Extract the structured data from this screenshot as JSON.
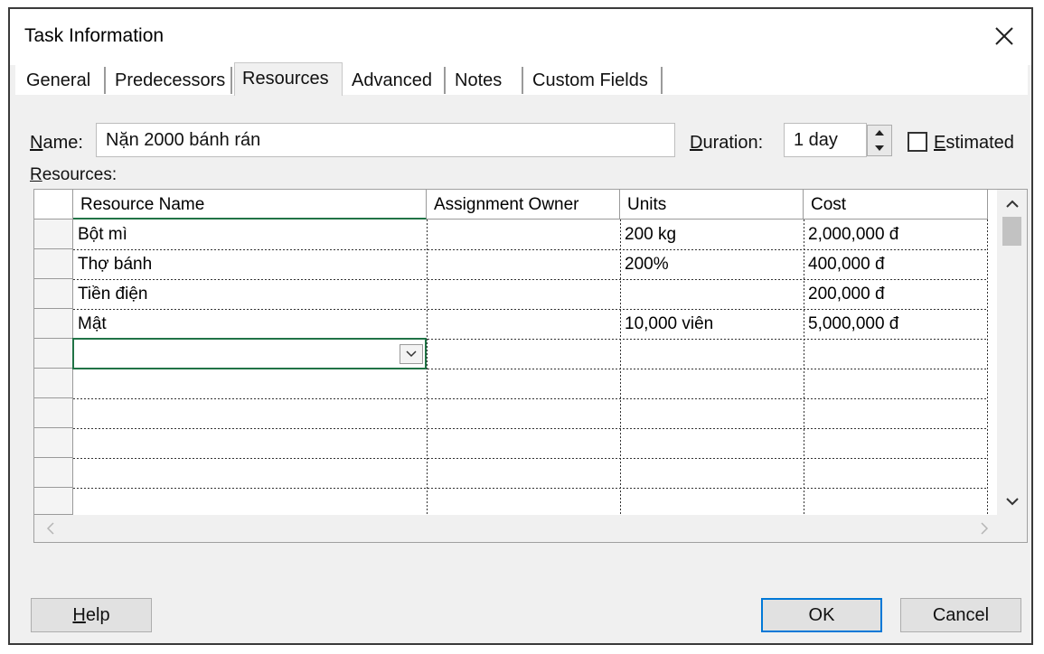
{
  "dialog": {
    "title": "Task Information"
  },
  "tabs": [
    {
      "label": "General"
    },
    {
      "label": "Predecessors"
    },
    {
      "label": "Resources"
    },
    {
      "label": "Advanced"
    },
    {
      "label": "Notes"
    },
    {
      "label": "Custom Fields"
    }
  ],
  "active_tab": "Resources",
  "name_field": {
    "label_first": "N",
    "label_rest": "ame:",
    "value": "Nặn 2000 bánh rán"
  },
  "duration_field": {
    "label_first": "D",
    "label_rest": "uration:",
    "value": "1 day"
  },
  "estimated": {
    "label_first": "E",
    "label_rest": "stimated",
    "checked": false
  },
  "resources_label": {
    "first": "R",
    "rest": "esources:"
  },
  "table": {
    "columns": [
      "Resource Name",
      "Assignment Owner",
      "Units",
      "Cost"
    ],
    "rows": [
      {
        "resource_name": "Bột mì",
        "assignment_owner": "",
        "units": "200 kg",
        "cost": "2,000,000 đ"
      },
      {
        "resource_name": "Thợ bánh",
        "assignment_owner": "",
        "units": "200%",
        "cost": "400,000 đ"
      },
      {
        "resource_name": "Tiền điện",
        "assignment_owner": "",
        "units": "",
        "cost": "200,000 đ"
      },
      {
        "resource_name": "Mật",
        "assignment_owner": "",
        "units": "10,000 viên",
        "cost": "5,000,000 đ"
      },
      {
        "resource_name": "",
        "assignment_owner": "",
        "units": "",
        "cost": ""
      }
    ]
  },
  "buttons": {
    "help_first": "H",
    "help_rest": "elp",
    "ok": "OK",
    "cancel": "Cancel"
  },
  "colors": {
    "accent": "#0078d7",
    "active_cell": "#217346"
  }
}
